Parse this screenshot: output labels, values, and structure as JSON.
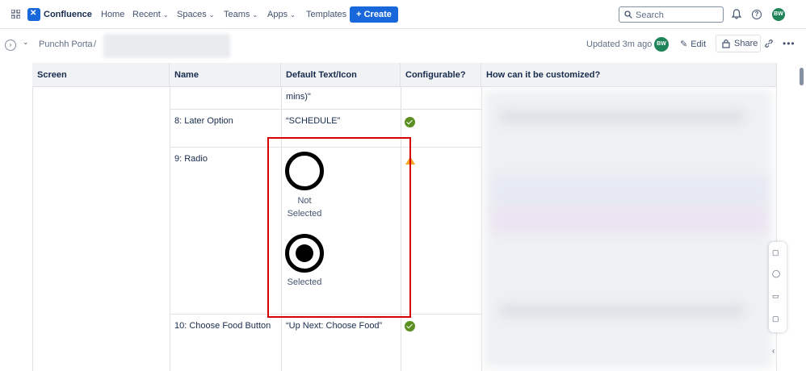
{
  "nav": {
    "brand": "Confluence",
    "home": "Home",
    "recent": "Recent",
    "spaces": "Spaces",
    "teams": "Teams",
    "apps": "Apps",
    "templates": "Templates",
    "create": "+ Create",
    "search_placeholder": "Search",
    "avatar": "BW"
  },
  "subheader": {
    "breadcrumb": "Punchh Porta",
    "separator": "/",
    "updated": "Updated 3m ago",
    "avatar": "BW",
    "edit": "Edit",
    "share": "Share"
  },
  "table": {
    "headers": [
      "Screen",
      "Name",
      "Default Text/Icon",
      "Configurable?",
      "How can it be customized?"
    ],
    "rows": [
      {
        "name": "",
        "default_text": "mins)\"",
        "configurable": ""
      },
      {
        "name": "8: Later Option",
        "default_text": "“SCHEDULE”",
        "configurable": "check"
      },
      {
        "name": "9: Radio",
        "default_text": "",
        "configurable": "warning",
        "radio_states": [
          "Not\nSelected",
          "Selected"
        ]
      },
      {
        "name": "10: Choose Food Button",
        "default_text": "“Up Next: Choose Food”",
        "configurable": "check"
      }
    ]
  },
  "colors": {
    "accent": "#1868db",
    "check": "#5b8f22",
    "warning": "#f5a623",
    "highlight": "#d50000"
  }
}
